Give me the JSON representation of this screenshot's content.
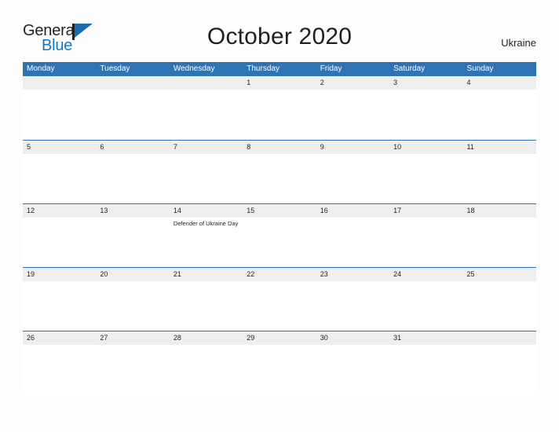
{
  "brand": {
    "name_part1": "General",
    "name_part2": "Blue",
    "flag_icon": "flag-icon",
    "accent_color": "#1277c4",
    "header_color": "#2e74b5"
  },
  "header": {
    "title": "October 2020",
    "country": "Ukraine"
  },
  "calendar": {
    "day_headers": [
      "Monday",
      "Tuesday",
      "Wednesday",
      "Thursday",
      "Friday",
      "Saturday",
      "Sunday"
    ],
    "weeks": [
      {
        "days": [
          {
            "num": "",
            "events": []
          },
          {
            "num": "",
            "events": []
          },
          {
            "num": "",
            "events": []
          },
          {
            "num": "1",
            "events": []
          },
          {
            "num": "2",
            "events": []
          },
          {
            "num": "3",
            "events": []
          },
          {
            "num": "4",
            "events": []
          }
        ]
      },
      {
        "days": [
          {
            "num": "5",
            "events": []
          },
          {
            "num": "6",
            "events": []
          },
          {
            "num": "7",
            "events": []
          },
          {
            "num": "8",
            "events": []
          },
          {
            "num": "9",
            "events": []
          },
          {
            "num": "10",
            "events": []
          },
          {
            "num": "11",
            "events": []
          }
        ]
      },
      {
        "days": [
          {
            "num": "12",
            "events": []
          },
          {
            "num": "13",
            "events": []
          },
          {
            "num": "14",
            "events": [
              "Defender of Ukraine Day"
            ]
          },
          {
            "num": "15",
            "events": []
          },
          {
            "num": "16",
            "events": []
          },
          {
            "num": "17",
            "events": []
          },
          {
            "num": "18",
            "events": []
          }
        ]
      },
      {
        "days": [
          {
            "num": "19",
            "events": []
          },
          {
            "num": "20",
            "events": []
          },
          {
            "num": "21",
            "events": []
          },
          {
            "num": "22",
            "events": []
          },
          {
            "num": "23",
            "events": []
          },
          {
            "num": "24",
            "events": []
          },
          {
            "num": "25",
            "events": []
          }
        ]
      },
      {
        "days": [
          {
            "num": "26",
            "events": []
          },
          {
            "num": "27",
            "events": []
          },
          {
            "num": "28",
            "events": []
          },
          {
            "num": "29",
            "events": []
          },
          {
            "num": "30",
            "events": []
          },
          {
            "num": "31",
            "events": []
          },
          {
            "num": "",
            "events": []
          }
        ]
      }
    ]
  }
}
